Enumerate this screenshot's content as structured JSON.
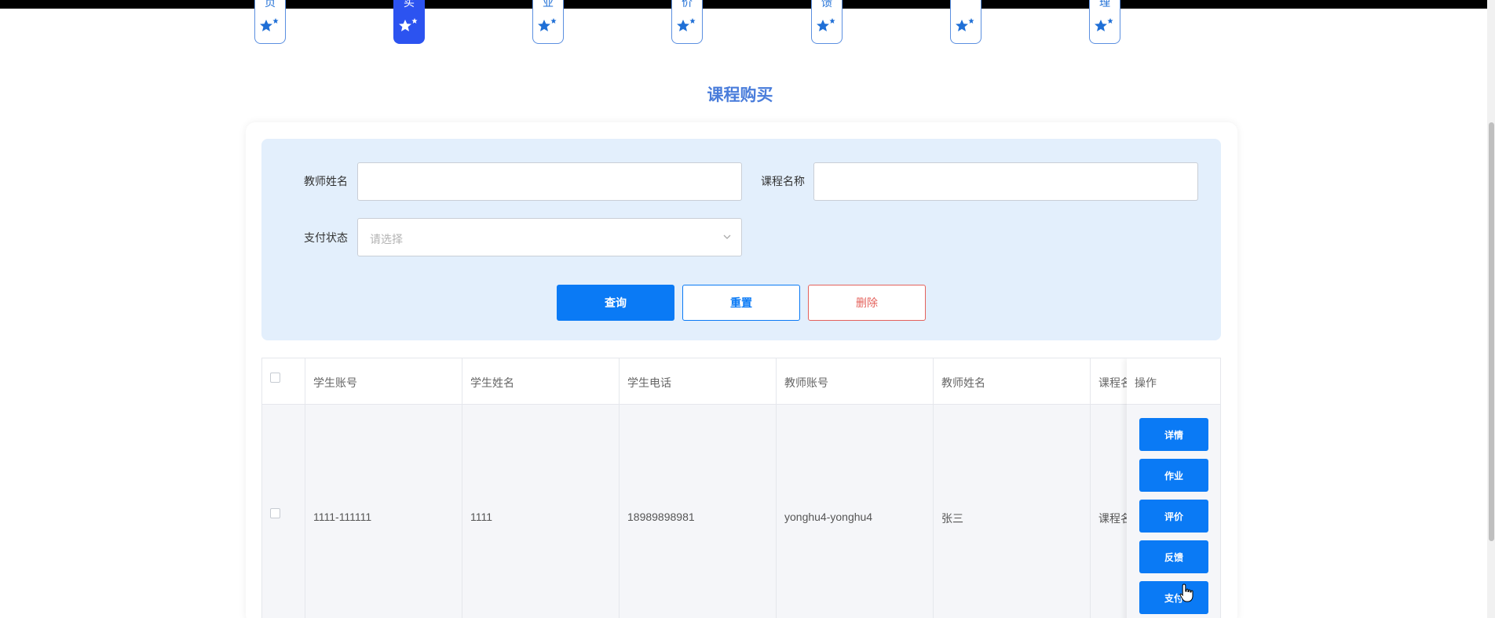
{
  "nav": {
    "tabs": [
      {
        "char": "页",
        "active": false
      },
      {
        "char": "买",
        "active": true
      },
      {
        "char": "业",
        "active": false
      },
      {
        "char": "价",
        "active": false
      },
      {
        "char": "馈",
        "active": false
      },
      {
        "char": "",
        "active": false
      },
      {
        "char": "理",
        "active": false
      }
    ]
  },
  "page": {
    "title": "课程购买"
  },
  "search": {
    "teacher_name_label": "教师姓名",
    "teacher_name_value": "",
    "course_name_label": "课程名称",
    "course_name_value": "",
    "pay_status_label": "支付状态",
    "pay_status_placeholder": "请选择",
    "query_label": "查询",
    "reset_label": "重置",
    "delete_label": "删除"
  },
  "table": {
    "headers": [
      "学生账号",
      "学生姓名",
      "学生电话",
      "教师账号",
      "教师姓名",
      "课程名"
    ],
    "ops_header": "操作",
    "rows": [
      {
        "cells": [
          "1111-111111",
          "1111",
          "18989898981",
          "yonghu4-yonghu4",
          "张三",
          "课程名"
        ],
        "ops": [
          "详情",
          "作业",
          "评价",
          "反馈",
          "支付"
        ]
      }
    ]
  },
  "colors": {
    "primary": "#0a7af5",
    "active_tab": "#2c53f0",
    "title": "#4a7ddb",
    "danger": "#e4615b",
    "panel_bg": "#e3effc"
  }
}
